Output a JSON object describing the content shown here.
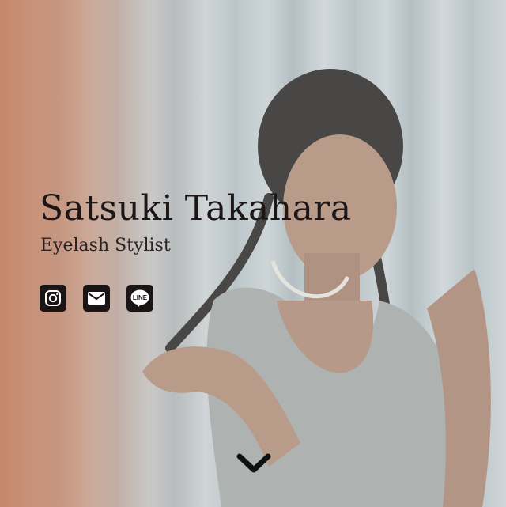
{
  "hero": {
    "name": "Satsuki Takahara",
    "role": "Eyelash Stylist",
    "background_accent": "#c4704c"
  },
  "social_links": [
    {
      "icon": "instagram-icon"
    },
    {
      "icon": "mail-icon"
    },
    {
      "icon": "line-icon",
      "label": "LINE"
    }
  ],
  "scroll": {
    "icon": "chevron-down-icon"
  }
}
